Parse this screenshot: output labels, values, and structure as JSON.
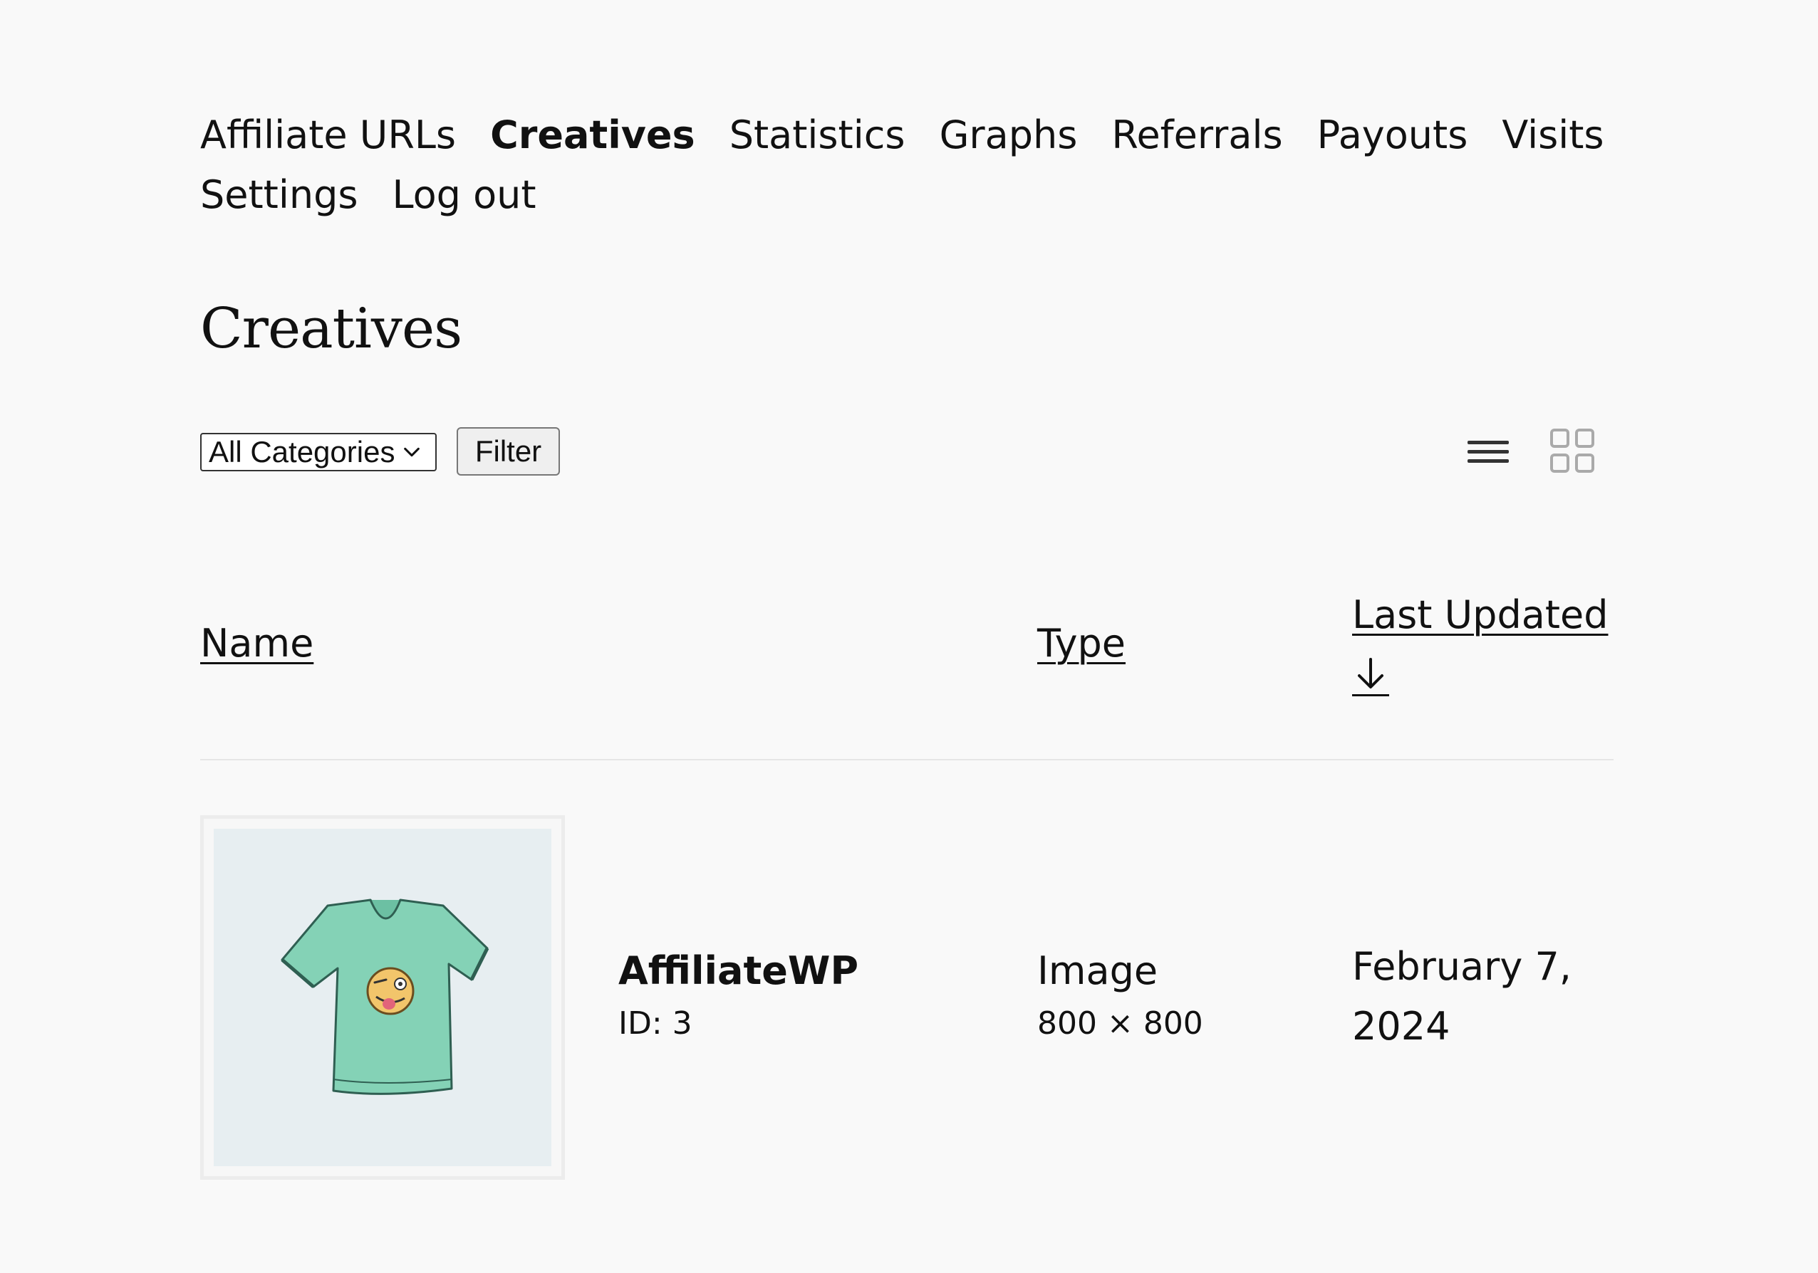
{
  "nav": {
    "items": [
      {
        "label": "Affiliate URLs",
        "active": false
      },
      {
        "label": "Creatives",
        "active": true
      },
      {
        "label": "Statistics",
        "active": false
      },
      {
        "label": "Graphs",
        "active": false
      },
      {
        "label": "Referrals",
        "active": false
      },
      {
        "label": "Payouts",
        "active": false
      },
      {
        "label": "Visits",
        "active": false
      },
      {
        "label": "Settings",
        "active": false
      },
      {
        "label": "Log out",
        "active": false
      }
    ]
  },
  "page": {
    "title": "Creatives"
  },
  "filter": {
    "category_selected": "All Categories",
    "button_label": "Filter"
  },
  "view_toggle": {
    "list_icon": "list-view-icon",
    "grid_icon": "grid-view-icon",
    "active": "list"
  },
  "table": {
    "columns": {
      "name": "Name",
      "type": "Type",
      "last_updated": "Last Updated"
    },
    "sort_icon": "arrow-down-icon",
    "rows": [
      {
        "thumbnail_icon": "t-shirt-image",
        "name": "AffiliateWP",
        "id": "ID: 3",
        "type": "Image",
        "size": "800 × 800",
        "date": "February 7, 2024"
      }
    ]
  },
  "colors": {
    "background": "#f9f9f9",
    "text": "#111111",
    "thumbnail_bg": "#e7eef1",
    "shirt": "#7fcfb0",
    "grid_icon_inactive": "#aaaaaa"
  }
}
